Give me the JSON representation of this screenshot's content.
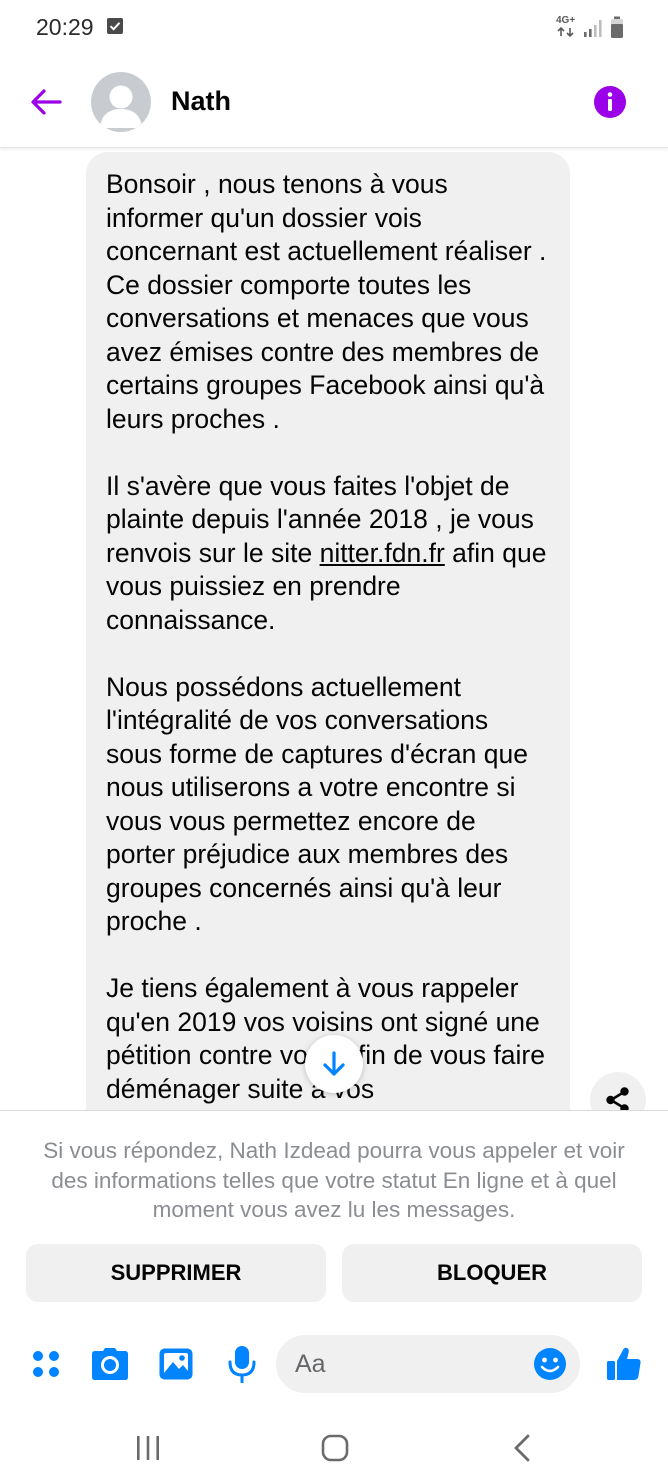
{
  "status_bar": {
    "time": "20:29",
    "network": "4G+",
    "icons": [
      "checkbox-notification-icon",
      "network-4g-icon",
      "signal-icon",
      "battery-icon"
    ]
  },
  "header": {
    "contact_name": "Nath",
    "accent_color": "#9b01e8",
    "icons": [
      "back-arrow-icon",
      "avatar-placeholder-icon",
      "info-icon"
    ]
  },
  "conversation": {
    "paragraphs": [
      "Bonsoir , nous tenons à vous informer qu'un dossier vois concernant est actuellement réaliser . Ce dossier comporte toutes les conversations et menaces que vous avez émises contre des membres de certains groupes Facebook ainsi qu'à leurs proches .",
      "Il s'avère que vous faites l'objet de plainte depuis l'année 2018 , je vous renvois sur le site",
      "Nous possédons actuellement l'intégralité de vos conversations sous forme de captures d'écran que nous utiliserons a votre encontre si vous vous permettez encore de porter préjudice aux membres des groupes concernés ainsi qu'à leur proche .",
      "Je tiens également à vous rappeler qu'en 2019 vos voisins ont signé une pétition contre vous afin de vous faire déménager suite à vos"
    ],
    "link_text": "nitter.fdn.fr",
    "after_link_text": "afin que vous puissiez en prendre connaissance.",
    "bubble_color": "#f0f0f0"
  },
  "message_request": {
    "notice": "Si vous répondez, Nath Izdead pourra vous appeler et voir des informations telles que votre statut En ligne et à quel moment vous avez lu les messages.",
    "delete_label": "SUPPRIMER",
    "block_label": "BLOQUER"
  },
  "composer": {
    "placeholder": "Aa",
    "accent_color": "#0084ff",
    "icons": [
      "menu-dots-icon",
      "camera-icon",
      "gallery-icon",
      "microphone-icon",
      "emoji-icon",
      "thumbs-up-icon"
    ]
  },
  "nav_bar": {
    "icons": [
      "recent-apps-icon",
      "home-icon",
      "back-icon"
    ]
  }
}
